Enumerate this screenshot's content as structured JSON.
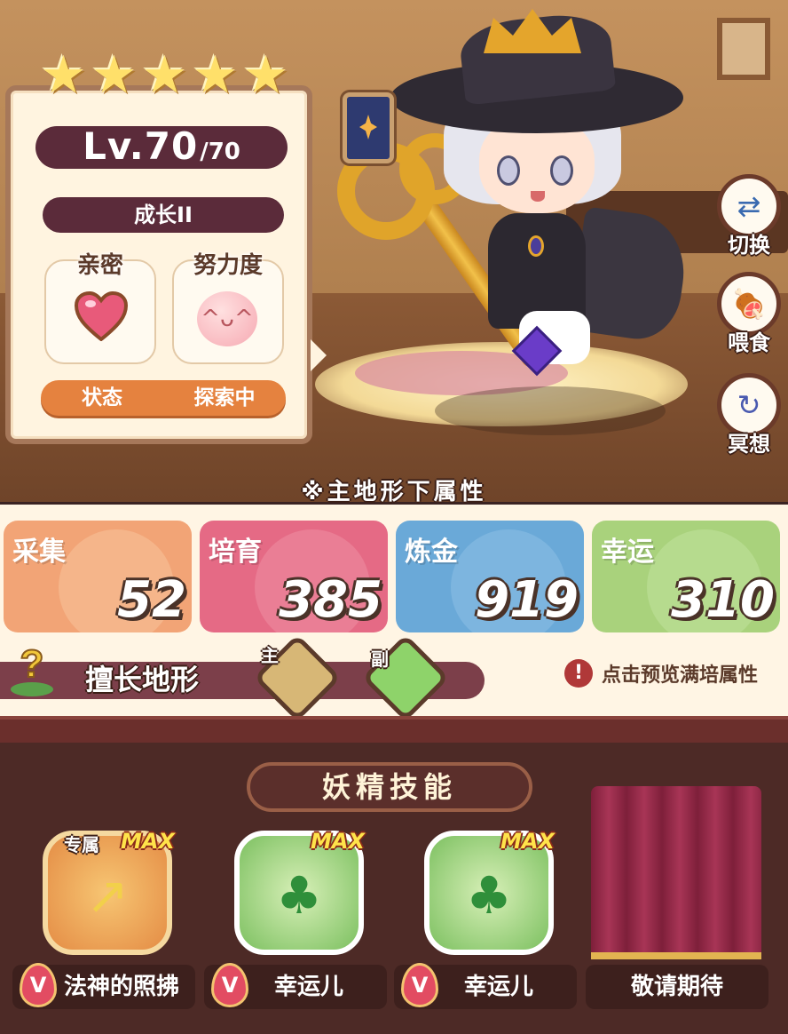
{
  "stars": [
    "★",
    "★",
    "★",
    "★",
    "★"
  ],
  "info": {
    "level_main": "Lv.70",
    "level_max": "/70",
    "growth": "成长II",
    "intimacy_label": "亲密",
    "effort_label": "努力度",
    "status_label": "状态",
    "status_value": "探索中"
  },
  "side_buttons": {
    "switch": "切换",
    "feed": "喂食",
    "meditate": "冥想"
  },
  "attributes_note": "※主地形下属性",
  "attributes": [
    {
      "name": "采集",
      "value": "52",
      "color": "#f2a476"
    },
    {
      "name": "培育",
      "value": "385",
      "color": "#e56a85"
    },
    {
      "name": "炼金",
      "value": "919",
      "color": "#6aa9d8"
    },
    {
      "name": "幸运",
      "value": "310",
      "color": "#a9d27c"
    }
  ],
  "terrain": {
    "label": "擅长地形",
    "main_tag": "主",
    "sub_tag": "副",
    "preview": "点击预览满培属性"
  },
  "skills": {
    "title": "妖精技能",
    "items": [
      {
        "name": "法神的照拂",
        "max": "MAX",
        "exclusive": "专属",
        "badge": "V"
      },
      {
        "name": "幸运儿",
        "max": "MAX",
        "badge": "V"
      },
      {
        "name": "幸运儿",
        "max": "MAX",
        "badge": "V"
      },
      {
        "name": "敬请期待"
      }
    ]
  },
  "colors": {
    "panel_dark": "#5b2b3a",
    "status_orange": "#e5823f",
    "skills_bg": "#4d2a26"
  }
}
